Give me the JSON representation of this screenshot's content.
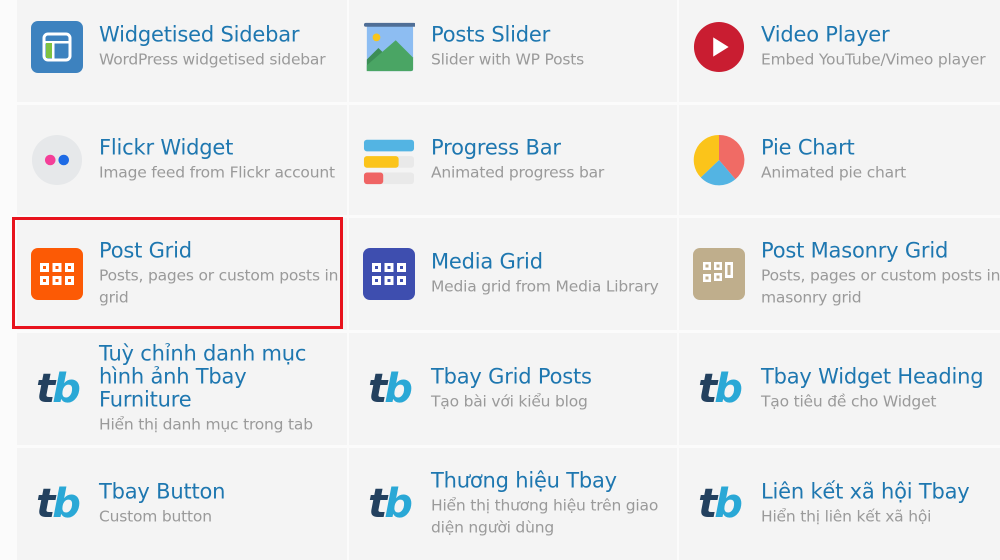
{
  "widgets": [
    {
      "title": "Widgetised Sidebar",
      "desc": "WordPress widgetised sidebar",
      "icon": "sidebar-layout-icon",
      "color": "#3d82bf"
    },
    {
      "title": "Posts Slider",
      "desc": "Slider with WP Posts",
      "icon": "image-slider-icon",
      "color": "#4aa564"
    },
    {
      "title": "Video Player",
      "desc": "Embed YouTube/Vimeo player",
      "icon": "play-icon",
      "color": "#c91d31"
    },
    {
      "title": "Flickr Widget",
      "desc": "Image feed from Flickr account",
      "icon": "flickr-icon",
      "color": "#e6e8ea"
    },
    {
      "title": "Progress Bar",
      "desc": "Animated progress bar",
      "icon": "progress-bar-icon",
      "color": "#4fb3e0"
    },
    {
      "title": "Pie Chart",
      "desc": "Animated pie chart",
      "icon": "pie-chart-icon",
      "color": "#f06b65"
    },
    {
      "title": "Post Grid",
      "desc": "Posts, pages or custom posts in grid",
      "icon": "grid-icon",
      "color": "#fc5a05",
      "highlighted": true
    },
    {
      "title": "Media Grid",
      "desc": "Media grid from Media Library",
      "icon": "grid-icon",
      "color": "#3e4eaf"
    },
    {
      "title": "Post Masonry Grid",
      "desc": "Posts, pages or custom posts in masonry grid",
      "icon": "masonry-grid-icon",
      "color": "#bfae8c"
    },
    {
      "title": "Tuỳ chỉnh danh mục hình ảnh Tbay Furniture",
      "desc": "Hiển thị danh mục trong tab",
      "icon": "tbay-logo-icon"
    },
    {
      "title": "Tbay Grid Posts",
      "desc": "Tạo bài với kiểu blog",
      "icon": "tbay-logo-icon"
    },
    {
      "title": "Tbay Widget Heading",
      "desc": "Tạo tiêu đề cho Widget",
      "icon": "tbay-logo-icon"
    },
    {
      "title": "Tbay Button",
      "desc": "Custom button",
      "icon": "tbay-logo-icon"
    },
    {
      "title": "Thương hiệu Tbay",
      "desc": "Hiển thị thương hiệu trên giao diện người dùng",
      "icon": "tbay-logo-icon"
    },
    {
      "title": "Liên kết xã hội Tbay",
      "desc": "Hiển thị liên kết xã hội",
      "icon": "tbay-logo-icon"
    }
  ],
  "tbay_logo": {
    "t": "t",
    "b": "b"
  },
  "highlight_color": "#e8131d"
}
